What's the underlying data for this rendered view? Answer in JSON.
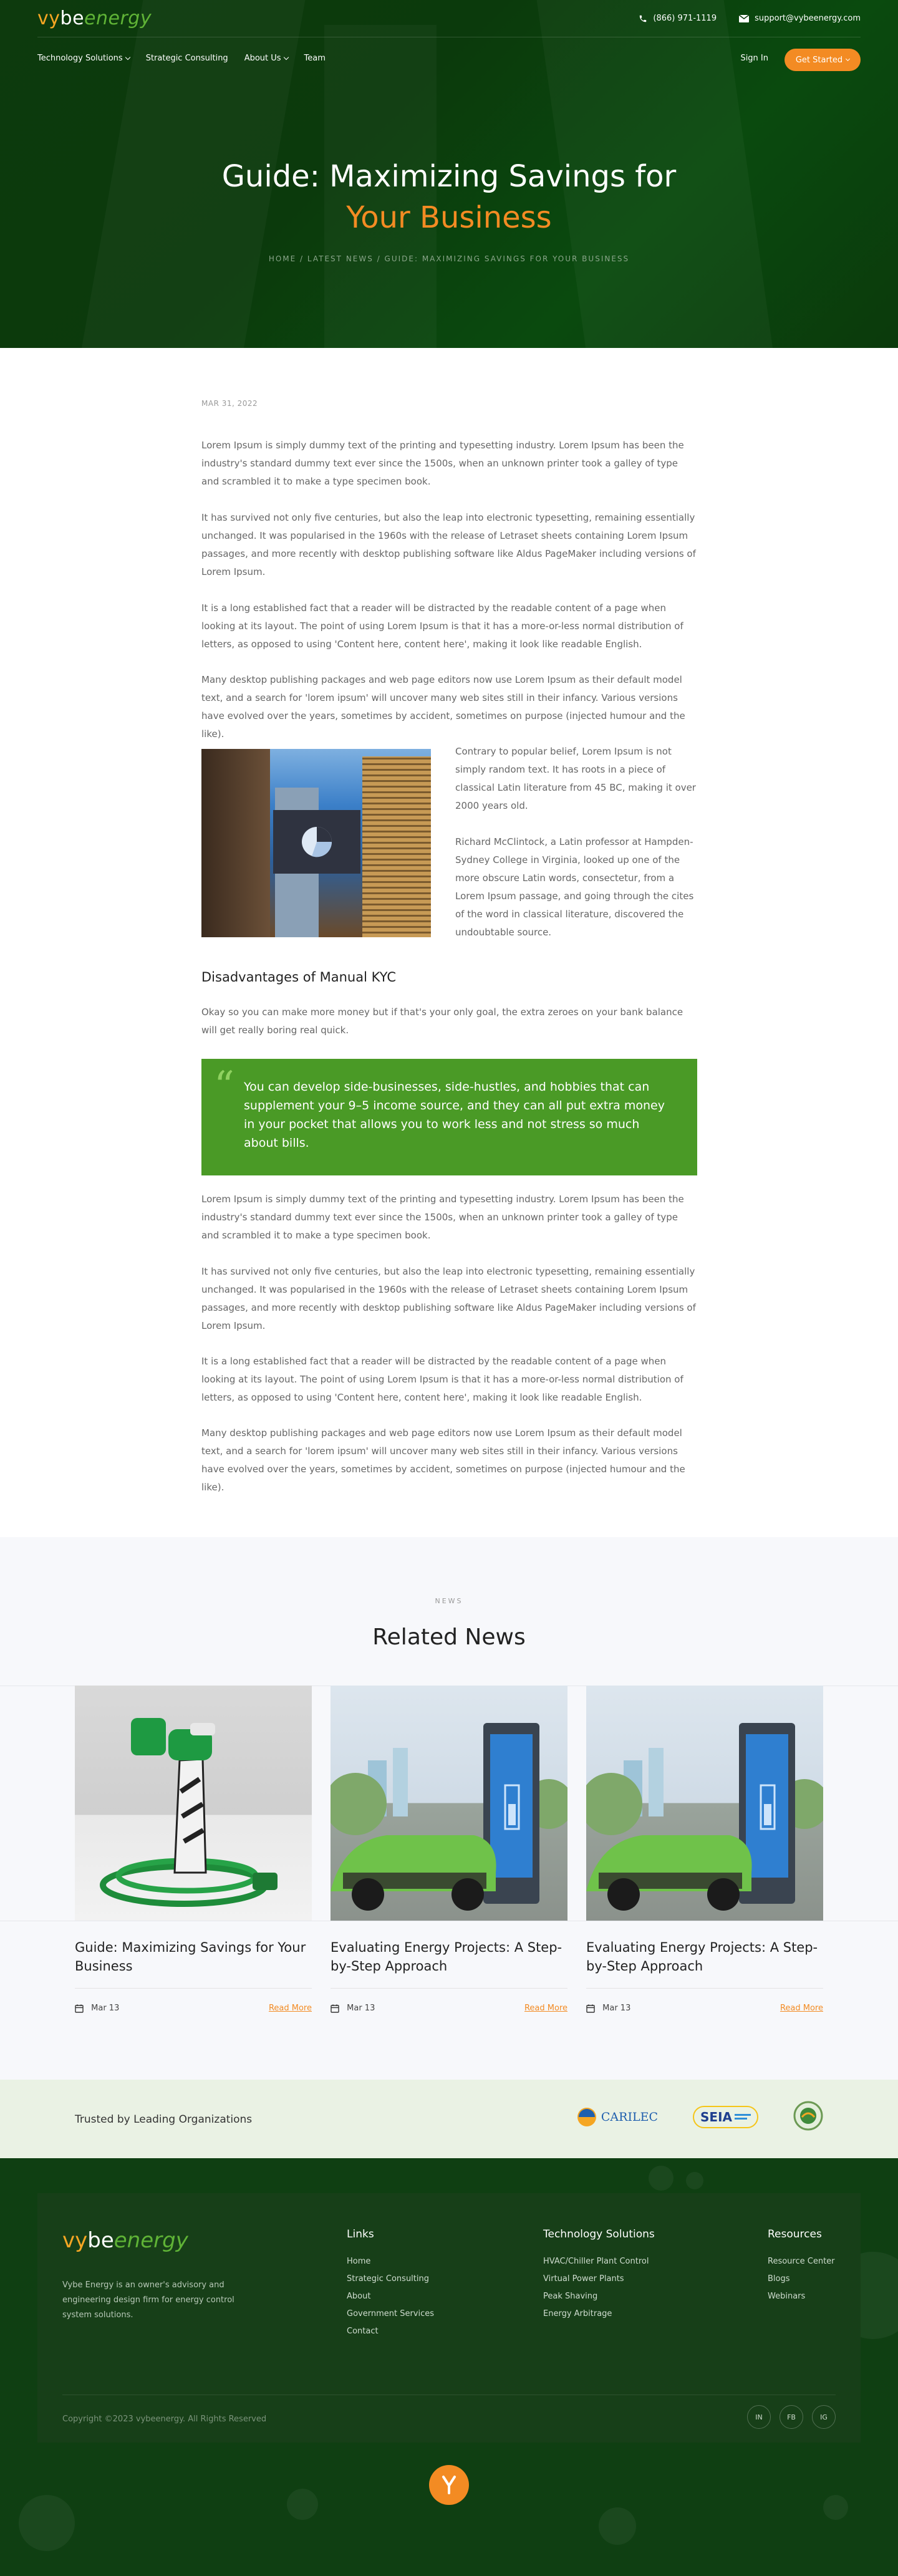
{
  "header": {
    "logo": {
      "v": "v",
      "y": "y",
      "be": "be",
      "energy": "energy"
    },
    "phone": "(866) 971-1119",
    "email": "support@vybeenergy.com",
    "nav": [
      {
        "label": "Technology Solutions",
        "dropdown": true
      },
      {
        "label": "Strategic Consulting",
        "dropdown": false
      },
      {
        "label": "About Us",
        "dropdown": true
      },
      {
        "label": "Team",
        "dropdown": false
      }
    ],
    "signin": "Sign In",
    "cta": "Get Started"
  },
  "hero": {
    "title_line1": "Guide: Maximizing Savings for",
    "title_line2": "Your Business",
    "breadcrumb": "HOME / LATEST NEWS / GUIDE: MAXIMIZING SAVINGS FOR YOUR BUSINESS"
  },
  "article": {
    "date": "MAR 31, 2022",
    "p1": "Lorem Ipsum is simply dummy text of the printing and typesetting industry. Lorem Ipsum has been the industry's standard dummy text ever since the 1500s, when an unknown printer took a galley of type and scrambled it to make a type specimen book.",
    "p2": "It has survived not only five centuries, but also the leap into electronic typesetting, remaining essentially unchanged. It was popularised in the 1960s with the release of Letraset sheets containing Lorem Ipsum passages, and more recently with desktop publishing software like Aldus PageMaker including versions of Lorem Ipsum.",
    "p3": "It is a long established fact that a reader will be distracted by the readable content of a page when looking at its layout. The point of using Lorem Ipsum is that it has a more-or-less normal distribution of letters, as opposed to using 'Content here, content here', making it look like readable English.",
    "p4": "Many desktop publishing packages and web page editors now use Lorem Ipsum as their default model text, and a search for 'lorem ipsum' will uncover many web sites still in their infancy. Various versions have evolved over the years, sometimes by accident, sometimes on purpose (injected humour and the like).",
    "side1": "Contrary to popular belief, Lorem Ipsum is not simply random text. It has roots in a piece of classical Latin literature from 45 BC, making it over 2000 years old.",
    "side2": "Richard McClintock, a Latin professor at Hampden-Sydney College in Virginia, looked up one of the more obscure Latin words, consectetur, from a Lorem Ipsum passage, and going through the cites of the word in classical literature, discovered the undoubtable source.",
    "subheading": "Disadvantages of Manual KYC",
    "p5": "Okay so you can make more money but if that's your only goal, the extra zeroes on your bank balance will get really boring real quick.",
    "quote": "You can develop side-businesses, side-hustles, and hobbies that can supplement your 9–5 income source, and they can all put extra money in your pocket that allows you to work less and not stress so much about bills.",
    "p6": "Lorem Ipsum is simply dummy text of the printing and typesetting industry. Lorem Ipsum has been the industry's standard dummy text ever since the 1500s, when an unknown printer took a galley of type and scrambled it to make a type specimen book.",
    "p7": "It has survived not only five centuries, but also the leap into electronic typesetting, remaining essentially unchanged. It was popularised in the 1960s with the release of Letraset sheets containing Lorem Ipsum passages, and more recently with desktop publishing software like Aldus PageMaker including versions of Lorem Ipsum.",
    "p8": "It is a long established fact that a reader will be distracted by the readable content of a page when looking at its layout. The point of using Lorem Ipsum is that it has a more-or-less normal distribution of letters, as opposed to using 'Content here, content here', making it look like readable English.",
    "p9": "Many desktop publishing packages and web page editors now use Lorem Ipsum as their default model text, and a search for 'lorem ipsum' will uncover many web sites still in their infancy. Various versions have evolved over the years, sometimes by accident, sometimes on purpose (injected humour and the like)."
  },
  "related": {
    "kicker": "NEWS",
    "title": "Related News",
    "cards": [
      {
        "title": "Guide: Maximizing Savings for Your Business",
        "date": "Mar 13",
        "read_more": "Read More"
      },
      {
        "title": "Evaluating Energy Projects: A Step-by-Step Approach",
        "date": "Mar 13",
        "read_more": "Read More"
      },
      {
        "title": "Evaluating Energy Projects: A Step-by-Step Approach",
        "date": "Mar 13",
        "read_more": "Read More"
      }
    ]
  },
  "trust": {
    "label": "Trusted by Leading Organizations",
    "logos": [
      "CARILEC",
      "SEIA"
    ]
  },
  "footer": {
    "description": "Vybe Energy is an owner's advisory and engineering design firm for energy control system solutions.",
    "columns": [
      {
        "heading": "Links",
        "items": [
          "Home",
          "Strategic Consulting",
          "About",
          "Government Services",
          "Contact"
        ]
      },
      {
        "heading": "Technology Solutions",
        "items": [
          "HVAC/Chiller Plant Control",
          "Virtual Power Plants",
          "Peak Shaving",
          "Energy Arbitrage"
        ]
      },
      {
        "heading": "Resources",
        "items": [
          "Resource Center",
          "Blogs",
          "Webinars"
        ]
      }
    ],
    "copyright": "Copyright ©2023 vybeenergy. All Rights Reserved",
    "social": [
      "IN",
      "FB",
      "IG"
    ]
  },
  "colors": {
    "brand_orange": "#f38b23",
    "brand_green": "#4a9a26",
    "dark_green": "#0f3f12"
  }
}
